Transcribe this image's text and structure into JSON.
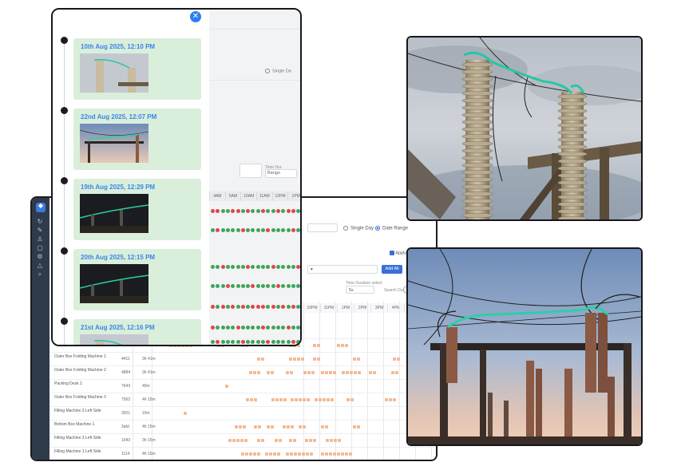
{
  "dashboard": {
    "filter": {
      "single_day": "Single Day",
      "date_range": "Date Range",
      "add_all": "Add All",
      "apply": "Apply",
      "time_slot_label": "Time Duration select",
      "time_slot_value": "5s",
      "search_label": "Search Du"
    },
    "hours": [
      "10PM",
      "11PM",
      "1PM",
      "2PM",
      "3PM",
      "4PM",
      "5PM",
      "6PM"
    ],
    "rows": [
      {
        "name": "Outer Box Folding Machine 2",
        "code": "4411",
        "duration": "3h 45m"
      },
      {
        "name": "Outer Box Folding Machine 1",
        "code": "4411",
        "duration": "3h 41m"
      },
      {
        "name": "Outer Box Folding Machine 2",
        "code": "4884",
        "duration": "3h 41m"
      },
      {
        "name": "Packing Desk 1",
        "code": "7643",
        "duration": "45m"
      },
      {
        "name": "Outer Box Folding Machine 3",
        "code": "7562",
        "duration": "4h 15m"
      },
      {
        "name": "Filling Machine 3 Left Side",
        "code": "3021",
        "duration": "15m"
      },
      {
        "name": "Bottom Box Machine 1",
        "code": "3afd",
        "duration": "4h 15m"
      },
      {
        "name": "Filling Machine 3 Left Side",
        "code": "1043",
        "duration": "3h 15m"
      },
      {
        "name": "Filling Machine 1 Left Side",
        "code": "1114",
        "duration": "4h 15m"
      }
    ]
  },
  "timeline_panel": {
    "close_icon": "close-icon",
    "background_labels": {
      "single_day": "Single Da",
      "time_label": "Time Dur.",
      "time_value": "Bango"
    },
    "background_hours": [
      "4AM",
      "5AM",
      "10AM",
      "11AM",
      "12PM",
      "1PM"
    ],
    "events": [
      {
        "date": "10th Aug 2025, 12:10 PM",
        "scene": "insulator"
      },
      {
        "date": "22nd Aug 2025, 12:07 PM",
        "scene": "sunset"
      },
      {
        "date": "19th Aug 2025, 12:29 PM",
        "scene": "night"
      },
      {
        "date": "20th Aug 2025, 12:15 PM",
        "scene": "night"
      },
      {
        "date": "21st Aug 2025, 12:16 PM",
        "scene": "insulator"
      }
    ]
  },
  "photos": [
    {
      "name": "insulator-closeup-photo"
    },
    {
      "name": "substation-dusk-photo"
    }
  ],
  "colors": {
    "accent": "#3c84e8",
    "card_bg": "#d9efdb",
    "frame": "#16161c",
    "timeline_bar": "#f4b992",
    "dot_green": "#3fa55a",
    "dot_red": "#e0454a"
  }
}
